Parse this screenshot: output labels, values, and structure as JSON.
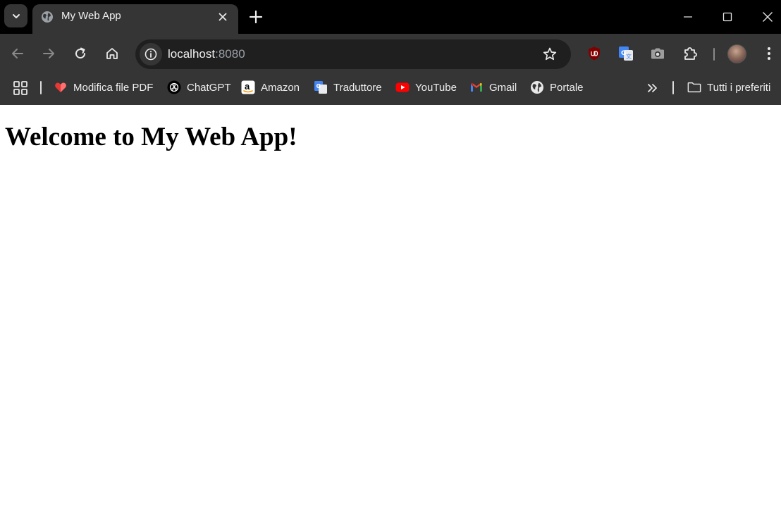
{
  "tab": {
    "title": "My Web App"
  },
  "omnibox": {
    "host": "localhost",
    "port": ":8080"
  },
  "bookmarks": [
    {
      "label": "Modifica file PDF",
      "icon": "pdf-heart-icon"
    },
    {
      "label": "ChatGPT",
      "icon": "chatgpt-icon"
    },
    {
      "label": "Amazon",
      "icon": "amazon-icon"
    },
    {
      "label": "Traduttore",
      "icon": "translate-icon"
    },
    {
      "label": "YouTube",
      "icon": "youtube-icon"
    },
    {
      "label": "Gmail",
      "icon": "gmail-icon"
    },
    {
      "label": "Portale",
      "icon": "globe-icon"
    }
  ],
  "all_bookmarks_label": "Tutti i preferiti",
  "page": {
    "heading": "Welcome to My Web App!"
  },
  "colors": {
    "tabstrip_bg": "#000000",
    "toolbar_bg": "#353535",
    "omnibox_bg": "#1f1f1f",
    "page_bg": "#ffffff"
  }
}
